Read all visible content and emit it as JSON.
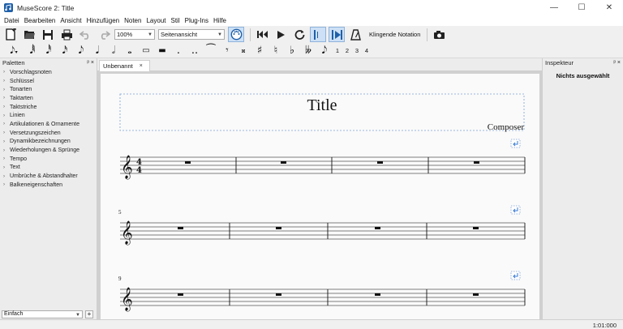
{
  "window": {
    "title": "MuseScore 2: Title",
    "controls": [
      "—",
      "☐",
      "✕"
    ]
  },
  "menubar": {
    "items": [
      {
        "label": "Datei"
      },
      {
        "label": "Bearbeiten"
      },
      {
        "label": "Ansicht"
      },
      {
        "label": "Hinzufügen"
      },
      {
        "label": "Noten"
      },
      {
        "label": "Layout"
      },
      {
        "label": "Stil"
      },
      {
        "label": "Plug-Ins"
      },
      {
        "label": "Hilfe"
      }
    ]
  },
  "toolbar": {
    "zoom_value": "100%",
    "view_mode_value": "Seitenansicht",
    "concert_pitch_label": "Klingende Notation",
    "icons": [
      "new-file-icon",
      "open-folder-icon",
      "save-icon",
      "print-icon",
      "undo-icon",
      "redo-icon",
      "midi-input-icon",
      "rewind-icon",
      "play-icon",
      "loop-icon",
      "loop-in-out-icon",
      "pan-score-icon",
      "metronome-icon",
      "camera-icon"
    ]
  },
  "note_toolbar": {
    "voices": [
      "1",
      "2",
      "3",
      "4"
    ]
  },
  "palettes": {
    "header": "Paletten",
    "header_controls": "ᵖ ×",
    "items": [
      {
        "label": "Vorschlagsnoten"
      },
      {
        "label": "Schlüssel"
      },
      {
        "label": "Tonarten"
      },
      {
        "label": "Taktarten"
      },
      {
        "label": "Taktstriche"
      },
      {
        "label": "Linien"
      },
      {
        "label": "Artikulationen & Ornamente"
      },
      {
        "label": "Versetzungszeichen"
      },
      {
        "label": "Dynamikbezeichnungen"
      },
      {
        "label": "Wiederholungen & Sprünge"
      },
      {
        "label": "Tempo"
      },
      {
        "label": "Text"
      },
      {
        "label": "Umbrüche & Abstandhalter"
      },
      {
        "label": "Balkeneigenschaften"
      }
    ],
    "workspace_value": "Einfach",
    "add_label": "+"
  },
  "score": {
    "tab_label": "Unbenannt",
    "tab_close": "×",
    "title": "Title",
    "composer": "Composer",
    "time_sig_top": "4",
    "time_sig_bottom": "4",
    "measure_number_2": "5",
    "measure_number_3": "9"
  },
  "inspector": {
    "header": "Inspekteur",
    "header_controls": "ᵖ ×",
    "status": "Nichts ausgewählt"
  },
  "statusbar": {
    "time": "1:01:000"
  },
  "colors": {
    "accent": "#3a7bd5",
    "panel_bg": "#ececec",
    "page_bg": "#fafafa",
    "canvas_bg": "#d0d0d0"
  }
}
